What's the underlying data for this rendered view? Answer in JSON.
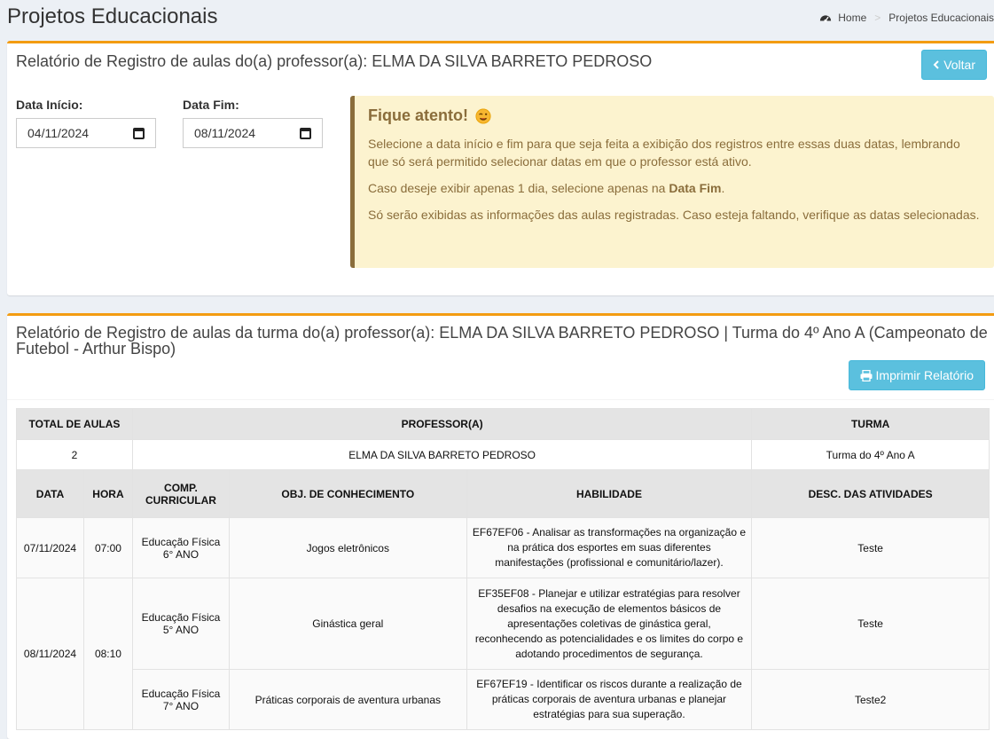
{
  "header": {
    "title": "Projetos Educacionais",
    "breadcrumb": {
      "home": "Home",
      "separator": ">",
      "current": "Projetos Educacionais"
    }
  },
  "filter": {
    "title": "Relatório de Registro de aulas do(a) professor(a): ELMA DA SILVA BARRETO PEDROSO",
    "back_label": "Voltar",
    "start_label": "Data Início:",
    "start_value": "04/11/2024",
    "end_label": "Data Fim:",
    "end_value": "08/11/2024"
  },
  "callout": {
    "title": "Fique atento!",
    "p1": "Selecione a data início e fim para que seja feita a exibição dos registros entre essas duas datas, lembrando que só será permitido selecionar datas em que o professor está ativo.",
    "p2_pre": "Caso deseje exibir apenas 1 dia, selecione apenas na ",
    "p2_bold": "Data Fim",
    "p2_post": ".",
    "p3": "Só serão exibidas as informações das aulas registradas. Caso esteja faltando, verifique as datas selecionadas."
  },
  "report": {
    "title": "Relatório de Registro de aulas da turma do(a) professor(a): ELMA DA SILVA BARRETO PEDROSO | Turma do 4º Ano A (Campeonato de Futebol - Arthur Bispo)",
    "print_label": "Imprimir Relatório",
    "summary_headers": {
      "total": "TOTAL DE AULAS",
      "professor": "PROFESSOR(A)",
      "turma": "TURMA"
    },
    "summary": {
      "total": "2",
      "professor": "ELMA DA SILVA BARRETO PEDROSO",
      "turma": "Turma do 4º Ano A"
    },
    "detail_headers": {
      "data": "DATA",
      "hora": "HORA",
      "comp_line1": "COMP.",
      "comp_line2": "CURRICULAR",
      "obj": "OBJ. DE CONHECIMENTO",
      "hab": "HABILIDADE",
      "desc": "DESC. DAS ATIVIDADES"
    },
    "rows": [
      {
        "data": "07/11/2024",
        "hora": "07:00",
        "comp1": "Educação Física",
        "comp2": "6° ANO",
        "obj": "Jogos eletrônicos",
        "hab": "EF67EF06 - Analisar as transformações na organização e na prática dos esportes em suas diferentes manifestações (profissional e comunitário/lazer).",
        "desc": "Teste"
      },
      {
        "data": "08/11/2024",
        "hora": "08:10",
        "comp1": "Educação Física",
        "comp2": "5° ANO",
        "obj": "Ginástica geral",
        "hab": "EF35EF08 - Planejar e utilizar estratégias para resolver desafios na execução de elementos básicos de apresentações coletivas de ginástica geral, reconhecendo as potencialidades e os limites do corpo e adotando procedimentos de segurança.",
        "desc": "Teste"
      },
      {
        "comp1": "Educação Física",
        "comp2": "7° ANO",
        "obj": "Práticas corporais de aventura urbanas",
        "hab": "EF67EF19 - Identificar os riscos durante a realização de práticas corporais de aventura urbanas e planejar estratégias para sua superação.",
        "desc": "Teste2"
      }
    ]
  }
}
